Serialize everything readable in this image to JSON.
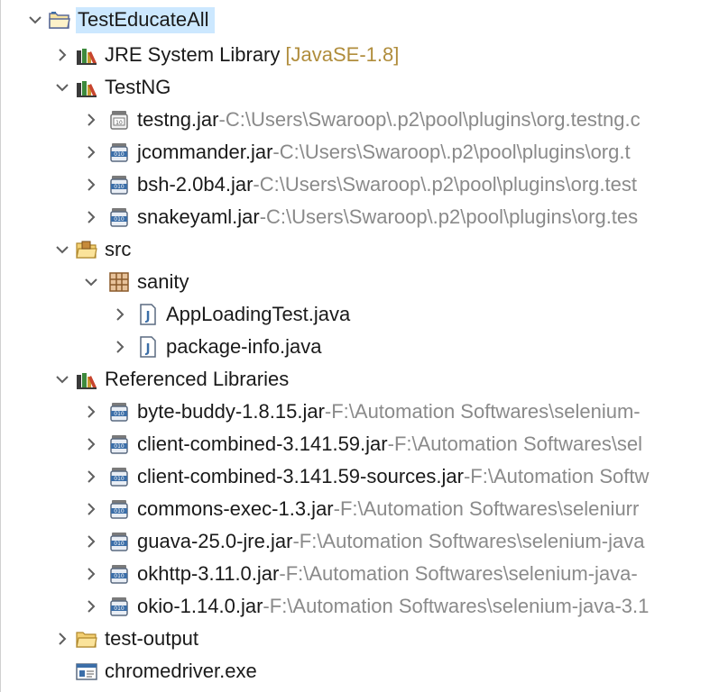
{
  "colors": {
    "selection": "#cce8ff",
    "label": "#1a1a1a",
    "path": "#8a8a8a",
    "decoration": "#b08d3c",
    "twisty": "#5f5f5f"
  },
  "tree": {
    "project": {
      "label": "TestEducateAll",
      "icon": "project-folder-icon",
      "expanded": true
    },
    "jre": {
      "label": "JRE System Library",
      "decoration": "[JavaSE-1.8]",
      "icon": "library-icon",
      "expanded": false
    },
    "testng": {
      "label": "TestNG",
      "icon": "library-icon",
      "expanded": true,
      "jars": [
        {
          "label": "testng.jar",
          "sep": " - ",
          "path": "C:\\Users\\Swaroop\\.p2\\pool\\plugins\\org.testng.c",
          "icon": "jar-source-icon"
        },
        {
          "label": "jcommander.jar",
          "sep": " - ",
          "path": "C:\\Users\\Swaroop\\.p2\\pool\\plugins\\org.t",
          "icon": "jar-icon"
        },
        {
          "label": "bsh-2.0b4.jar",
          "sep": " - ",
          "path": "C:\\Users\\Swaroop\\.p2\\pool\\plugins\\org.test",
          "icon": "jar-icon"
        },
        {
          "label": "snakeyaml.jar",
          "sep": " - ",
          "path": "C:\\Users\\Swaroop\\.p2\\pool\\plugins\\org.tes",
          "icon": "jar-icon"
        }
      ]
    },
    "src": {
      "label": "src",
      "icon": "source-folder-icon",
      "expanded": true
    },
    "package": {
      "label": "sanity",
      "icon": "package-icon",
      "expanded": true
    },
    "files": [
      {
        "label": "AppLoadingTest.java",
        "icon": "java-file-icon"
      },
      {
        "label": "package-info.java",
        "icon": "java-file-icon"
      }
    ],
    "referenced": {
      "label": "Referenced Libraries",
      "icon": "library-icon",
      "expanded": true,
      "jars": [
        {
          "label": "byte-buddy-1.8.15.jar",
          "sep": " - ",
          "path": "F:\\Automation Softwares\\selenium-"
        },
        {
          "label": "client-combined-3.141.59.jar",
          "sep": " - ",
          "path": "F:\\Automation Softwares\\sel"
        },
        {
          "label": "client-combined-3.141.59-sources.jar",
          "sep": " - ",
          "path": "F:\\Automation Softw"
        },
        {
          "label": "commons-exec-1.3.jar",
          "sep": " - ",
          "path": "F:\\Automation Softwares\\seleniurr"
        },
        {
          "label": "guava-25.0-jre.jar",
          "sep": " - ",
          "path": "F:\\Automation Softwares\\selenium-java"
        },
        {
          "label": "okhttp-3.11.0.jar",
          "sep": " - ",
          "path": "F:\\Automation Softwares\\selenium-java-"
        },
        {
          "label": "okio-1.14.0.jar",
          "sep": " - ",
          "path": "F:\\Automation Softwares\\selenium-java-3.1"
        }
      ]
    },
    "output": {
      "label": "test-output",
      "icon": "folder-icon",
      "expanded": false
    },
    "exe": {
      "label": "chromedriver.exe",
      "icon": "executable-file-icon"
    }
  }
}
